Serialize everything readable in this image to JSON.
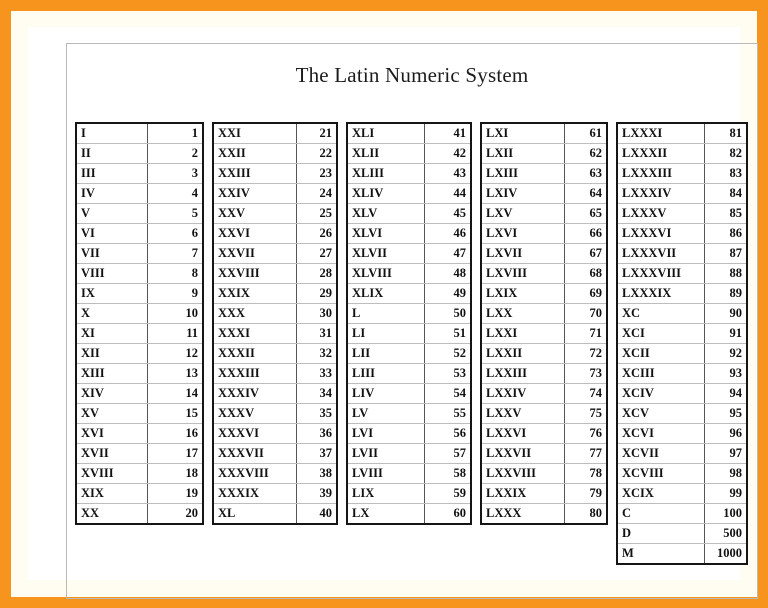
{
  "document": {
    "title": "The Latin Numeric System",
    "colors": {
      "border_accent": "#f7941e",
      "sheet": "#ffffff",
      "inner_rule": "#b9b9b9",
      "table_border": "#151515",
      "row_rule": "#bdbdbd",
      "text": "#111111"
    }
  },
  "tables": [
    {
      "id": "column-1",
      "rows": [
        {
          "roman": "I",
          "arabic": "1"
        },
        {
          "roman": "II",
          "arabic": "2"
        },
        {
          "roman": "III",
          "arabic": "3"
        },
        {
          "roman": "IV",
          "arabic": "4"
        },
        {
          "roman": "V",
          "arabic": "5"
        },
        {
          "roman": "VI",
          "arabic": "6"
        },
        {
          "roman": "VII",
          "arabic": "7"
        },
        {
          "roman": "VIII",
          "arabic": "8"
        },
        {
          "roman": "IX",
          "arabic": "9"
        },
        {
          "roman": "X",
          "arabic": "10"
        },
        {
          "roman": "XI",
          "arabic": "11"
        },
        {
          "roman": "XII",
          "arabic": "12"
        },
        {
          "roman": "XIII",
          "arabic": "13"
        },
        {
          "roman": "XIV",
          "arabic": "14"
        },
        {
          "roman": "XV",
          "arabic": "15"
        },
        {
          "roman": "XVI",
          "arabic": "16"
        },
        {
          "roman": "XVII",
          "arabic": "17"
        },
        {
          "roman": "XVIII",
          "arabic": "18"
        },
        {
          "roman": "XIX",
          "arabic": "19"
        },
        {
          "roman": "XX",
          "arabic": "20"
        }
      ]
    },
    {
      "id": "column-2",
      "rows": [
        {
          "roman": "XXI",
          "arabic": "21"
        },
        {
          "roman": "XXII",
          "arabic": "22"
        },
        {
          "roman": "XXIII",
          "arabic": "23"
        },
        {
          "roman": "XXIV",
          "arabic": "24"
        },
        {
          "roman": "XXV",
          "arabic": "25"
        },
        {
          "roman": "XXVI",
          "arabic": "26"
        },
        {
          "roman": "XXVII",
          "arabic": "27"
        },
        {
          "roman": "XXVIII",
          "arabic": "28"
        },
        {
          "roman": "XXIX",
          "arabic": "29"
        },
        {
          "roman": "XXX",
          "arabic": "30"
        },
        {
          "roman": "XXXI",
          "arabic": "31"
        },
        {
          "roman": "XXXII",
          "arabic": "32"
        },
        {
          "roman": "XXXIII",
          "arabic": "33"
        },
        {
          "roman": "XXXIV",
          "arabic": "34"
        },
        {
          "roman": "XXXV",
          "arabic": "35"
        },
        {
          "roman": "XXXVI",
          "arabic": "36"
        },
        {
          "roman": "XXXVII",
          "arabic": "37"
        },
        {
          "roman": "XXXVIII",
          "arabic": "38"
        },
        {
          "roman": "XXXIX",
          "arabic": "39"
        },
        {
          "roman": "XL",
          "arabic": "40"
        }
      ]
    },
    {
      "id": "column-3",
      "rows": [
        {
          "roman": "XLI",
          "arabic": "41"
        },
        {
          "roman": "XLII",
          "arabic": "42"
        },
        {
          "roman": "XLIII",
          "arabic": "43"
        },
        {
          "roman": "XLIV",
          "arabic": "44"
        },
        {
          "roman": "XLV",
          "arabic": "45"
        },
        {
          "roman": "XLVI",
          "arabic": "46"
        },
        {
          "roman": "XLVII",
          "arabic": "47"
        },
        {
          "roman": "XLVIII",
          "arabic": "48"
        },
        {
          "roman": "XLIX",
          "arabic": "49"
        },
        {
          "roman": "L",
          "arabic": "50"
        },
        {
          "roman": "LI",
          "arabic": "51"
        },
        {
          "roman": "LII",
          "arabic": "52"
        },
        {
          "roman": "LIII",
          "arabic": "53"
        },
        {
          "roman": "LIV",
          "arabic": "54"
        },
        {
          "roman": "LV",
          "arabic": "55"
        },
        {
          "roman": "LVI",
          "arabic": "56"
        },
        {
          "roman": "LVII",
          "arabic": "57"
        },
        {
          "roman": "LVIII",
          "arabic": "58"
        },
        {
          "roman": "LIX",
          "arabic": "59"
        },
        {
          "roman": "LX",
          "arabic": "60"
        }
      ]
    },
    {
      "id": "column-4",
      "rows": [
        {
          "roman": "LXI",
          "arabic": "61"
        },
        {
          "roman": "LXII",
          "arabic": "62"
        },
        {
          "roman": "LXIII",
          "arabic": "63"
        },
        {
          "roman": "LXIV",
          "arabic": "64"
        },
        {
          "roman": "LXV",
          "arabic": "65"
        },
        {
          "roman": "LXVI",
          "arabic": "66"
        },
        {
          "roman": "LXVII",
          "arabic": "67"
        },
        {
          "roman": "LXVIII",
          "arabic": "68"
        },
        {
          "roman": "LXIX",
          "arabic": "69"
        },
        {
          "roman": "LXX",
          "arabic": "70"
        },
        {
          "roman": "LXXI",
          "arabic": "71"
        },
        {
          "roman": "LXXII",
          "arabic": "72"
        },
        {
          "roman": "LXXIII",
          "arabic": "73"
        },
        {
          "roman": "LXXIV",
          "arabic": "74"
        },
        {
          "roman": "LXXV",
          "arabic": "75"
        },
        {
          "roman": "LXXVI",
          "arabic": "76"
        },
        {
          "roman": "LXXVII",
          "arabic": "77"
        },
        {
          "roman": "LXXVIII",
          "arabic": "78"
        },
        {
          "roman": "LXXIX",
          "arabic": "79"
        },
        {
          "roman": "LXXX",
          "arabic": "80"
        }
      ]
    },
    {
      "id": "column-5",
      "rows": [
        {
          "roman": "LXXXI",
          "arabic": "81"
        },
        {
          "roman": "LXXXII",
          "arabic": "82"
        },
        {
          "roman": "LXXXIII",
          "arabic": "83"
        },
        {
          "roman": "LXXXIV",
          "arabic": "84"
        },
        {
          "roman": "LXXXV",
          "arabic": "85"
        },
        {
          "roman": "LXXXVI",
          "arabic": "86"
        },
        {
          "roman": "LXXXVII",
          "arabic": "87"
        },
        {
          "roman": "LXXXVIII",
          "arabic": "88"
        },
        {
          "roman": "LXXXIX",
          "arabic": "89"
        },
        {
          "roman": "XC",
          "arabic": "90"
        },
        {
          "roman": "XCI",
          "arabic": "91"
        },
        {
          "roman": "XCII",
          "arabic": "92"
        },
        {
          "roman": "XCIII",
          "arabic": "93"
        },
        {
          "roman": "XCIV",
          "arabic": "94"
        },
        {
          "roman": "XCV",
          "arabic": "95"
        },
        {
          "roman": "XCVI",
          "arabic": "96"
        },
        {
          "roman": "XCVII",
          "arabic": "97"
        },
        {
          "roman": "XCVIII",
          "arabic": "98"
        },
        {
          "roman": "XCIX",
          "arabic": "99"
        },
        {
          "roman": "C",
          "arabic": "100"
        },
        {
          "roman": "D",
          "arabic": "500"
        },
        {
          "roman": "M",
          "arabic": "1000"
        }
      ]
    }
  ]
}
